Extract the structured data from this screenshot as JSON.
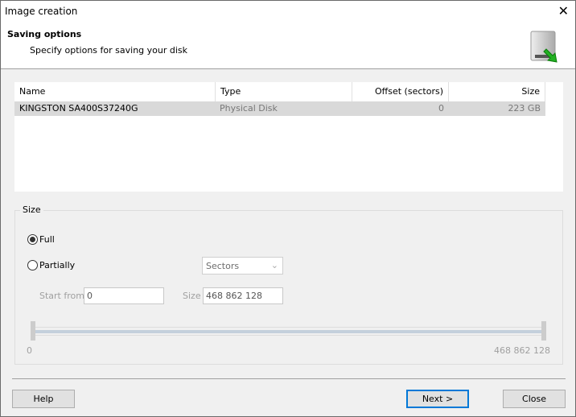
{
  "window": {
    "title": "Image creation",
    "close_icon": "close-icon"
  },
  "header": {
    "title": "Saving options",
    "subtitle": "Specify options for saving your disk",
    "icon": "disk-save-icon"
  },
  "table": {
    "columns": [
      "Name",
      "Type",
      "Offset (sectors)",
      "Size"
    ],
    "rows": [
      {
        "name": "KINGSTON SA400S37240G",
        "type": "Physical Disk",
        "offset": "0",
        "size": "223 GB",
        "selected": true
      }
    ]
  },
  "size_group": {
    "label": "Size",
    "full_label": "Full",
    "full_selected": true,
    "partial_label": "Partially",
    "partial_selected": false,
    "unit": "Sectors",
    "start_label": "Start from",
    "start_value": "0",
    "size_label": "Size",
    "size_value": "468 862 128",
    "slider_min": "0",
    "slider_max": "468 862 128",
    "range_start_fraction": 0,
    "range_end_fraction": 1
  },
  "buttons": {
    "help": "Help",
    "next": "Next >",
    "close": "Close"
  },
  "colors": {
    "accent": "#0078d7",
    "selected_row": "#d9d9d9"
  }
}
